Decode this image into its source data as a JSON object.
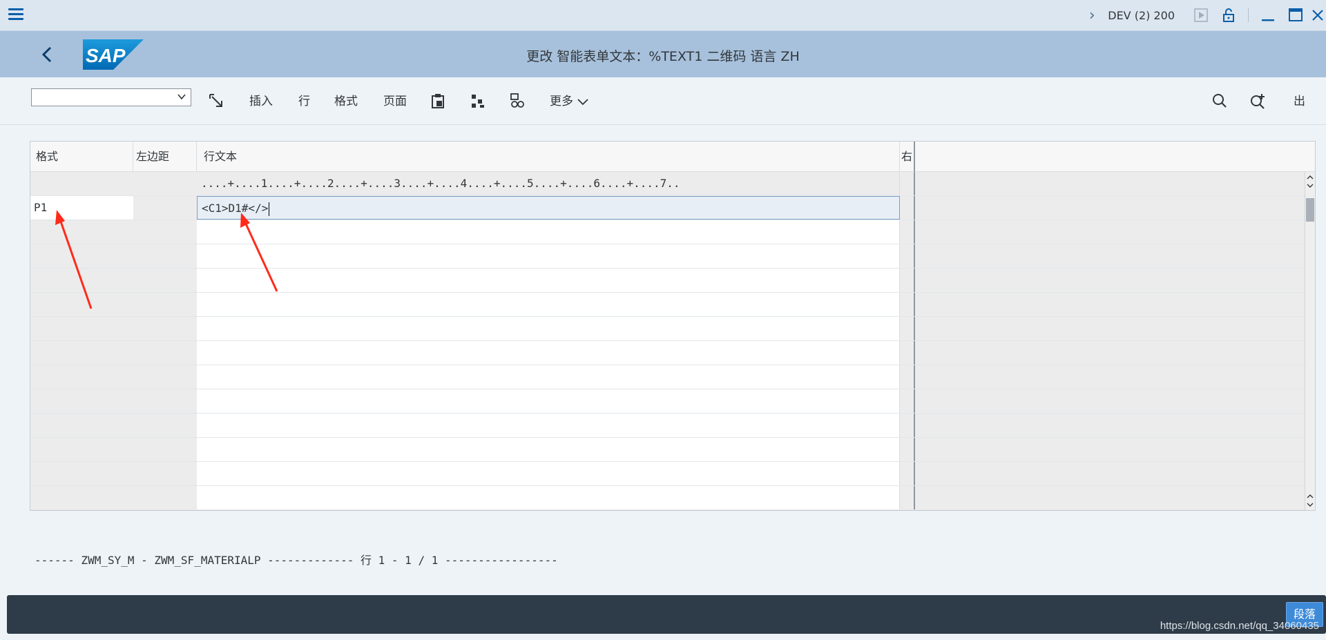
{
  "system_bar": {
    "system_label": "DEV (2) 200",
    "icons": [
      "menu-icon",
      "chevron-right-icon",
      "play-icon",
      "unlock-icon",
      "minimize-icon",
      "maximize-icon",
      "close-icon"
    ]
  },
  "title_bar": {
    "logo_text": "SAP",
    "title": "更改 智能表单文本：%TEXT1 二维码 语言 ZH"
  },
  "toolbar": {
    "combo_value": "",
    "insert": "插入",
    "line": "行",
    "format": "格式",
    "page": "页面",
    "more": "更多",
    "right_last": "出"
  },
  "editor": {
    "headers": {
      "format": "格式",
      "left_margin": "左边距",
      "line_text": "行文本",
      "right": "右"
    },
    "ruler": "....+....1....+....2....+....3....+....4....+....5....+....6....+....7..",
    "rows": [
      {
        "format": "P1",
        "text": "<C1>D1#</>"
      },
      {
        "format": "",
        "text": ""
      },
      {
        "format": "",
        "text": ""
      },
      {
        "format": "",
        "text": ""
      },
      {
        "format": "",
        "text": ""
      },
      {
        "format": "",
        "text": ""
      },
      {
        "format": "",
        "text": ""
      },
      {
        "format": "",
        "text": ""
      },
      {
        "format": "",
        "text": ""
      },
      {
        "format": "",
        "text": ""
      },
      {
        "format": "",
        "text": ""
      },
      {
        "format": "",
        "text": ""
      },
      {
        "format": "",
        "text": ""
      }
    ]
  },
  "status_line": "------ ZWM_SY_M - ZWM_SF_MATERIALP ------------- 行 1 - 1 / 1 -----------------",
  "footer": {
    "button": "段落"
  },
  "watermark": "https://blog.csdn.net/qq_34060435",
  "colors": {
    "titlebar": "#a7c1dc",
    "sysbar": "#dce6f0",
    "footer": "#2e3b48",
    "annotation": "#ff2a1a"
  }
}
